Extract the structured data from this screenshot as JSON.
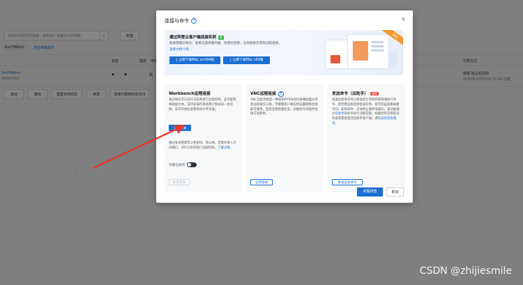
{
  "background": {
    "search_placeholder": "选择实例属性项搜索，或者输入关键字识别搜索",
    "tag_button": "标签",
    "search_tag": "8vx746zcn",
    "clear_filter": "清空筛选条件",
    "col_tag": "标签",
    "col_monitor": "监控",
    "col_avail": "可用",
    "col_billing": "付费方式",
    "instance_link": "0vx746zcn",
    "instance_date": "2022101​0",
    "billing_value": "按量-抢占式实例",
    "billing_date": "2022年10月10日 21:41 创建",
    "btn_start": "启动",
    "btn_stop": "重启",
    "btn_reset": "重置实例密码",
    "btn_renew": "续费",
    "btn_convert": "按量付费转包年包月",
    "btn_release": "释放设置",
    "row_text": "机",
    "colors": {
      "bg": "#f3f4f6",
      "link": "#1a6fd3"
    }
  },
  "modal": {
    "title": "连接与命令",
    "close": "×",
    "banner": {
      "title": "通过阿里云客户端连接实例",
      "badge": "新",
      "desc": "帮助管理云账号，查看与连接服务器，免密码连接，全局搜索实例及远程连接。",
      "link": "查看文档介绍",
      "btn_arm": "立即下载Mac arm64版",
      "btn_x64": "立即下载Mac x64版",
      "ribbon": "限免"
    },
    "cards": [
      {
        "title": "Workbench远程连接",
        "desc1": "通过网页可以对ECS实例进行远程控制，支持复制和粘贴文本，支持多操作系统用户登录同一台实例，支持可视化查看系统文件资源。",
        "button": "立即登录",
        "desc2": "通过会话管理可以免密码，免公网，无需开放入方向端口，对ECS实例进行远程控制，",
        "desc2_link": "了解详情。",
        "toggle_label": "功能已关闭",
        "button2": "免密登录"
      },
      {
        "title": "VNC远程连接",
        "desc": "VNC远程连接是一种使用RFB协议的屏幕画面分享及远程操作工具。不需要客户端实例设置网络连接即可使用。但其连接质量较差，仅推荐作为临时连接方案使用。",
        "button": "立即登录"
      },
      {
        "title": "发送命令（云助手）",
        "badge": "推荐",
        "desc_a": "发送远程命令可以帮助您在实例内部快速执行命令，即无需远程连接登录实例，即可完成查看磁盘空间、安装软件、启动停止服务等操作。该功能通过",
        "desc_link": "云助手",
        "desc_b": "的命令执行功能实现，如果您的实例还没有安装或者激活云助手客户端，请先",
        "desc_link2": "安装或者激活",
        "desc_c": "。",
        "button": "发送远程命令"
      }
    ],
    "footer": {
      "primary": "问题排查",
      "secondary": "取消"
    }
  },
  "annotation": {
    "step": "4",
    "arrow_color": "#e8392c"
  },
  "watermark": "CSDN @zhijiesmile"
}
